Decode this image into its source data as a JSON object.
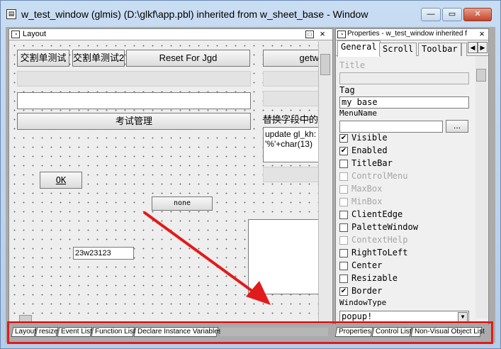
{
  "window": {
    "title": "w_test_window (glmis) (D:\\glkf\\app.pbl) inherited from w_sheet_base - Window",
    "icon": "window-icon",
    "controls": {
      "minimize": "—",
      "maximize": "▭",
      "close": "✕"
    }
  },
  "layout": {
    "title": "Layout",
    "controls": {
      "maximize": "□",
      "close": "×"
    },
    "buttons": {
      "b1": "交割单测试",
      "b2": "交割单测试2",
      "b3": "Reset For Jgd",
      "b4": "getw",
      "b5": "考试管理",
      "ok": "OK",
      "none": "none"
    },
    "static_text": "替换字段中的[",
    "mle_text_line1": "update gl_kh:",
    "mle_text_line2": "'%'+char(13)",
    "edit_value": "23w23123"
  },
  "properties": {
    "title": "Properties - w_test_window inherited f",
    "controls": {
      "close": "×"
    },
    "tabs": [
      "General",
      "Scroll",
      "Toolbar"
    ],
    "selected_tab": "General",
    "fields": {
      "title_label": "Title",
      "title_value": "",
      "tag_label": "Tag",
      "tag_value": "my base",
      "menuname_label": "MenuName",
      "menuname_value": "",
      "browse_label": "...",
      "windowtype_label": "WindowType",
      "windowtype_value": "popup!"
    },
    "checks": [
      {
        "label": "Visible",
        "checked": true,
        "enabled": true
      },
      {
        "label": "Enabled",
        "checked": true,
        "enabled": true
      },
      {
        "label": "TitleBar",
        "checked": false,
        "enabled": true
      },
      {
        "label": "ControlMenu",
        "checked": false,
        "enabled": false
      },
      {
        "label": "MaxBox",
        "checked": false,
        "enabled": false
      },
      {
        "label": "MinBox",
        "checked": false,
        "enabled": false
      },
      {
        "label": "ClientEdge",
        "checked": false,
        "enabled": true
      },
      {
        "label": "PaletteWindow",
        "checked": false,
        "enabled": true
      },
      {
        "label": "ContextHelp",
        "checked": false,
        "enabled": false
      },
      {
        "label": "RightToLeft",
        "checked": false,
        "enabled": true
      },
      {
        "label": "Center",
        "checked": false,
        "enabled": true
      },
      {
        "label": "Resizable",
        "checked": false,
        "enabled": true
      },
      {
        "label": "Border",
        "checked": true,
        "enabled": true
      }
    ]
  },
  "bottom_tabs_left": [
    "Layout",
    "resize",
    "Event List",
    "Function List",
    "Declare Instance Variables"
  ],
  "bottom_tabs_right": [
    "Properties",
    "Control List",
    "Non-Visual Object List"
  ],
  "colors": {
    "highlight_red": "#e11b1b",
    "arrow_red": "#e11b1b"
  }
}
